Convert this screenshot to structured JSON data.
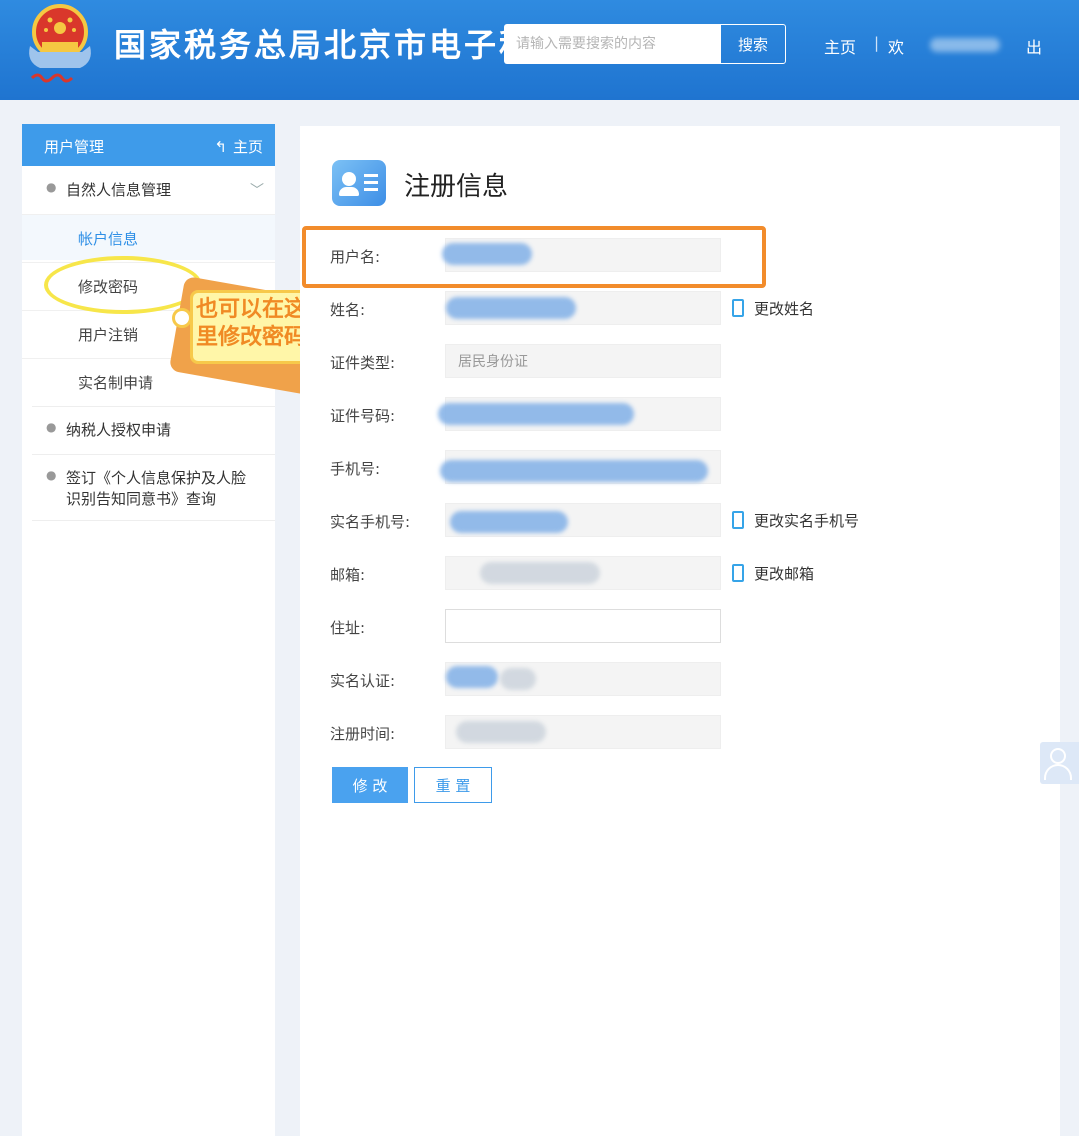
{
  "header": {
    "site_title": "国家税务总局北京市电子税",
    "search_placeholder": "请输入需要搜索的内容",
    "search_label": "搜索",
    "home_label": "主页",
    "separator": "|",
    "user_prefix": "欢",
    "logout_label": "出"
  },
  "sidebar": {
    "title": "用户管理",
    "home_label": "主页",
    "groups": [
      {
        "label": "自然人信息管理"
      },
      {
        "label": "纳税人授权申请"
      },
      {
        "label": "签订《个人信息保护及人脸识别告知同意书》查询"
      }
    ],
    "sub_items": [
      {
        "label": "帐户信息"
      },
      {
        "label": "修改密码"
      },
      {
        "label": "用户注销"
      },
      {
        "label": "实名制申请"
      }
    ]
  },
  "annotation": {
    "text": "也可以在这里修改密码"
  },
  "main": {
    "title": "注册信息",
    "fields": [
      {
        "label": "用户名:",
        "value": ""
      },
      {
        "label": "姓名:",
        "value": ""
      },
      {
        "label": "证件类型:",
        "value": "居民身份证"
      },
      {
        "label": "证件号码:",
        "value": ""
      },
      {
        "label": "手机号:",
        "value": ""
      },
      {
        "label": "实名手机号:",
        "value": ""
      },
      {
        "label": "邮箱:",
        "value": ""
      },
      {
        "label": "住址:",
        "value": ""
      },
      {
        "label": "实名认证:",
        "value": ""
      },
      {
        "label": "注册时间:",
        "value": ""
      }
    ],
    "links": {
      "change_name": "更改姓名",
      "change_phone": "更改实名手机号",
      "change_email": "更改邮箱"
    },
    "modify_label": "修 改",
    "reset_label": "重 置"
  },
  "colors": {
    "header_blue": "#1f74d0",
    "accent_blue": "#3e9bea",
    "highlight_orange": "#f28c2b",
    "annotation_yellow": "#f7e64a"
  }
}
